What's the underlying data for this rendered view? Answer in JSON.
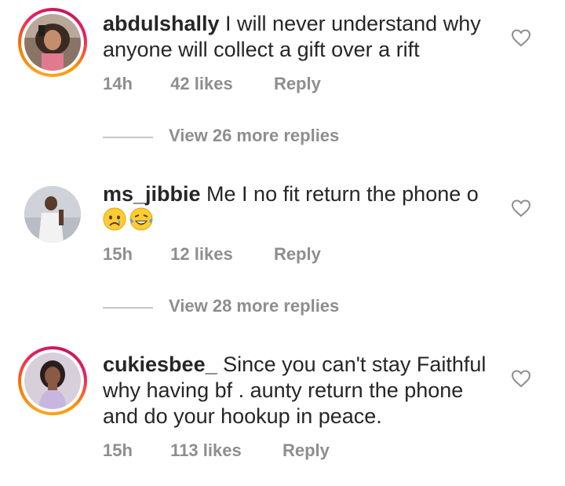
{
  "comments": [
    {
      "username": "abdulshally",
      "text": " I will never understand why anyone will collect a gift over a rift",
      "time": "14h",
      "likes": "42 likes",
      "reply": "Reply",
      "view_more": "View 26 more replies",
      "has_story_ring": true,
      "emojis": []
    },
    {
      "username": "ms_jibbie",
      "text": " Me I no fit return the phone o",
      "time": "15h",
      "likes": "12 likes",
      "reply": "Reply",
      "view_more": "View 28 more replies",
      "has_story_ring": false,
      "emojis": [
        "crying-face",
        "laughing-tears-face"
      ]
    },
    {
      "username": "cukiesbee_",
      "text": " Since you can't stay Faithful why having bf . aunty return the phone and do your hookup in peace.",
      "time": "15h",
      "likes": "113 likes",
      "reply": "Reply",
      "has_story_ring": true,
      "emojis": []
    }
  ],
  "icons": {
    "like": "heart-outline-icon"
  },
  "colors": {
    "text": "#262626",
    "secondary": "#8e8e8e",
    "divider": "#c7c7c7"
  }
}
